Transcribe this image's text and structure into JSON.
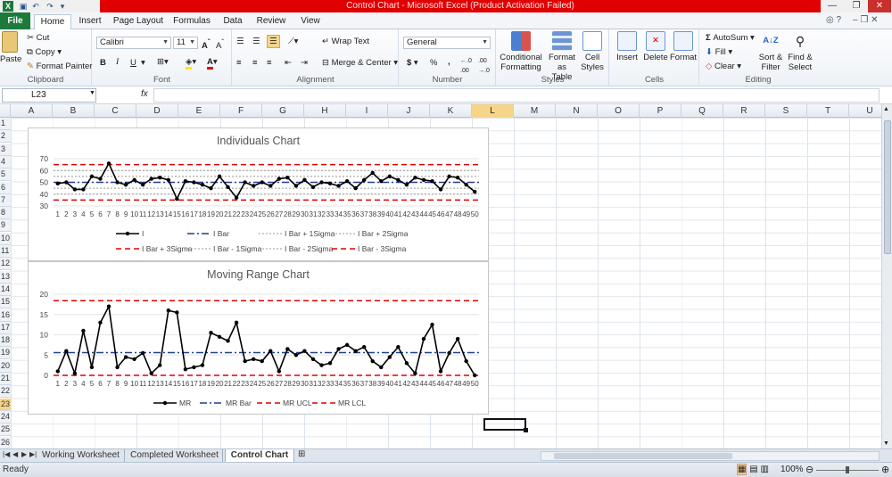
{
  "window": {
    "title": "Control Chart  -  Microsoft Excel (Product Activation Failed)"
  },
  "tabs": [
    "File",
    "Home",
    "Insert",
    "Page Layout",
    "Formulas",
    "Data",
    "Review",
    "View"
  ],
  "ribbon": {
    "clipboard": {
      "label": "Clipboard",
      "paste": "Paste",
      "cut": "Cut",
      "copy": "Copy",
      "format_painter": "Format Painter"
    },
    "font": {
      "label": "Font",
      "family": "Calibri",
      "size": "11",
      "bold": "B",
      "italic": "I",
      "underline": "U"
    },
    "alignment": {
      "label": "Alignment",
      "wrap": "Wrap Text",
      "merge": "Merge & Center"
    },
    "number": {
      "label": "Number",
      "format": "General",
      "currency": "$",
      "percent": "%",
      "comma": ","
    },
    "styles": {
      "label": "Styles",
      "conditional": "Conditional Formatting",
      "format_table": "Format as Table",
      "cell_styles": "Cell Styles"
    },
    "cells": {
      "label": "Cells",
      "insert": "Insert",
      "delete": "Delete",
      "format": "Format"
    },
    "editing": {
      "label": "Editing",
      "autosum": "AutoSum",
      "fill": "Fill",
      "clear": "Clear",
      "sort": "Sort & Filter",
      "find": "Find & Select"
    }
  },
  "formula_bar": {
    "name_box": "L23",
    "fx": "fx",
    "value": ""
  },
  "columns": [
    "A",
    "B",
    "C",
    "D",
    "E",
    "F",
    "G",
    "H",
    "I",
    "J",
    "K",
    "L",
    "M",
    "N",
    "O",
    "P",
    "Q",
    "R",
    "S",
    "T",
    "U"
  ],
  "selected_column": "L",
  "rows": [
    "1",
    "2",
    "3",
    "4",
    "5",
    "6",
    "7",
    "8",
    "9",
    "10",
    "11",
    "12",
    "13",
    "14",
    "15",
    "16",
    "17",
    "18",
    "19",
    "20",
    "21",
    "22",
    "23",
    "24",
    "25",
    "26"
  ],
  "selected_row": "23",
  "chart_data": [
    {
      "type": "line",
      "title": "Individuals Chart",
      "x": [
        1,
        2,
        3,
        4,
        5,
        6,
        7,
        8,
        9,
        10,
        11,
        12,
        13,
        14,
        15,
        16,
        17,
        18,
        19,
        20,
        21,
        22,
        23,
        24,
        25,
        26,
        27,
        28,
        29,
        30,
        31,
        32,
        33,
        34,
        35,
        36,
        37,
        38,
        39,
        40,
        41,
        42,
        43,
        44,
        45,
        46,
        47,
        48,
        49,
        50
      ],
      "ylim": [
        30,
        70
      ],
      "yticks": [
        30,
        40,
        50,
        60,
        70
      ],
      "series": [
        {
          "name": "I",
          "style": "solid-marker",
          "color": "#000000",
          "values": [
            49,
            50,
            44,
            44,
            55,
            53,
            66,
            50,
            48,
            52,
            48,
            53,
            54,
            52,
            36,
            51,
            50,
            48,
            45,
            55,
            46,
            37,
            50,
            47,
            50,
            47,
            53,
            54,
            47,
            52,
            46,
            50,
            49,
            47,
            51,
            45,
            52,
            58,
            51,
            55,
            52,
            48,
            54,
            52,
            51,
            44,
            55,
            54,
            48,
            42
          ]
        },
        {
          "name": "I Bar",
          "style": "dash-dot",
          "color": "#1f3f8f",
          "values": [
            50
          ]
        },
        {
          "name": "I Bar + 1Sigma",
          "style": "dotted",
          "color": "#999999",
          "values": [
            55
          ]
        },
        {
          "name": "I Bar + 2Sigma",
          "style": "dotted",
          "color": "#999999",
          "values": [
            60
          ]
        },
        {
          "name": "I Bar + 3Sigma",
          "style": "dashed",
          "color": "#e00000",
          "values": [
            65
          ]
        },
        {
          "name": "I Bar - 1Sigma",
          "style": "dotted",
          "color": "#999999",
          "values": [
            45
          ]
        },
        {
          "name": "I Bar - 2Sigma",
          "style": "dotted",
          "color": "#999999",
          "values": [
            40
          ]
        },
        {
          "name": "I Bar - 3Sigma",
          "style": "dashed",
          "color": "#e00000",
          "values": [
            35
          ]
        }
      ],
      "legend": "bottom"
    },
    {
      "type": "line",
      "title": "Moving Range Chart",
      "x": [
        1,
        2,
        3,
        4,
        5,
        6,
        7,
        8,
        9,
        10,
        11,
        12,
        13,
        14,
        15,
        16,
        17,
        18,
        19,
        20,
        21,
        22,
        23,
        24,
        25,
        26,
        27,
        28,
        29,
        30,
        31,
        32,
        33,
        34,
        35,
        36,
        37,
        38,
        39,
        40,
        41,
        42,
        43,
        44,
        45,
        46,
        47,
        48,
        49,
        50
      ],
      "ylim": [
        0,
        20
      ],
      "yticks": [
        0,
        5,
        10,
        15,
        20
      ],
      "series": [
        {
          "name": "MR",
          "style": "solid-marker",
          "color": "#000000",
          "values": [
            1,
            6,
            0.5,
            11,
            2,
            13,
            17,
            2,
            4.5,
            4,
            5.5,
            0.5,
            2.5,
            16,
            15.5,
            1.5,
            2,
            2.5,
            10.5,
            9.5,
            8.5,
            13,
            3.5,
            4,
            3.5,
            6,
            1,
            6.5,
            5,
            6,
            4,
            2.5,
            3,
            6.5,
            7.5,
            6,
            7,
            3.5,
            2,
            4.5,
            7,
            3,
            0.5,
            9,
            12.5,
            1,
            5.5,
            9,
            3.5,
            0
          ]
        },
        {
          "name": "MR Bar",
          "style": "dash-dot",
          "color": "#1f3f8f",
          "values": [
            5.6
          ]
        },
        {
          "name": "MR UCL",
          "style": "dashed",
          "color": "#e00000",
          "values": [
            18.4
          ]
        },
        {
          "name": "MR LCL",
          "style": "dashed",
          "color": "#e00000",
          "values": [
            0
          ]
        }
      ],
      "legend": "bottom"
    }
  ],
  "sheets": [
    "Working Worksheet",
    "Completed Worksheet",
    "Control Chart"
  ],
  "active_sheet": "Control Chart",
  "status": {
    "text": "Ready",
    "zoom": "100%"
  }
}
